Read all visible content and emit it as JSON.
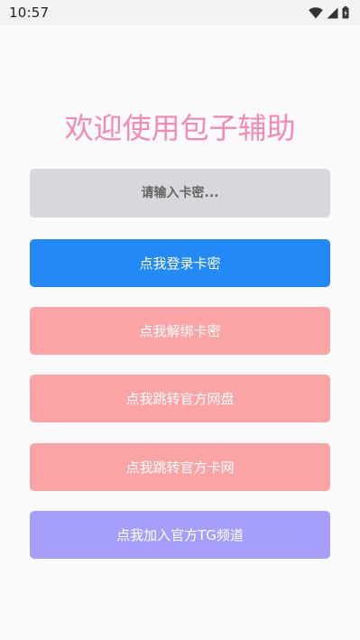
{
  "status_bar": {
    "time": "10:57",
    "icons": [
      "wifi-icon",
      "signal-icon",
      "battery-icon"
    ]
  },
  "page": {
    "title": "欢迎使用包子辅助"
  },
  "card_input": {
    "placeholder": "请输入卡密...",
    "value": ""
  },
  "buttons": {
    "login": "点我登录卡密",
    "unbind": "点我解绑卡密",
    "cloud_drive": "点我跳转官方网盘",
    "card_shop": "点我跳转官方卡网",
    "telegram": "点我加入官方TG频道"
  },
  "colors": {
    "title": "#f38ab6",
    "input_bg": "#d8d8dc",
    "login": "#2289f7",
    "unbind": "#fba4a6",
    "cloud_drive": "#fba4a6",
    "card_shop": "#fba4a6",
    "telegram": "#a59ffb"
  }
}
